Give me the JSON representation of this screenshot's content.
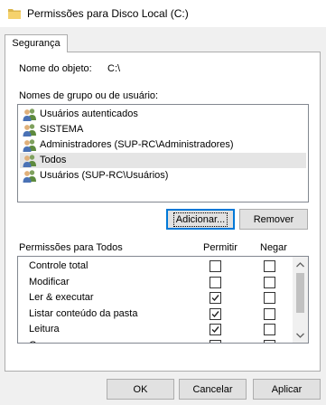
{
  "window": {
    "title": "Permissões para Disco Local (C:)",
    "icon": "folder-icon"
  },
  "tabs": [
    {
      "label": "Segurança",
      "active": true
    }
  ],
  "object": {
    "label": "Nome do objeto:",
    "value": "C:\\"
  },
  "groups": {
    "label": "Nomes de grupo ou de usuário:",
    "items": [
      {
        "label": "Usuários autenticados",
        "icon": "users-icon",
        "selected": false
      },
      {
        "label": "SISTEMA",
        "icon": "users-icon",
        "selected": false
      },
      {
        "label": "Administradores (SUP-RC\\Administradores)",
        "icon": "users-icon",
        "selected": false
      },
      {
        "label": "Todos",
        "icon": "users-icon",
        "selected": true
      },
      {
        "label": "Usuários (SUP-RC\\Usuários)",
        "icon": "users-icon",
        "selected": false
      }
    ],
    "add_label": "Adicionar...",
    "remove_label": "Remover"
  },
  "permissions": {
    "title": "Permissões para Todos",
    "allow_header": "Permitir",
    "deny_header": "Negar",
    "rows": [
      {
        "name": "Controle total",
        "allow": false,
        "deny": false
      },
      {
        "name": "Modificar",
        "allow": false,
        "deny": false
      },
      {
        "name": "Ler & executar",
        "allow": true,
        "deny": false
      },
      {
        "name": "Listar conteúdo da pasta",
        "allow": true,
        "deny": false
      },
      {
        "name": "Leitura",
        "allow": true,
        "deny": false
      },
      {
        "name": "Gravar",
        "allow": false,
        "deny": false
      }
    ]
  },
  "footer": {
    "ok_label": "OK",
    "cancel_label": "Cancelar",
    "apply_label": "Aplicar"
  },
  "colors": {
    "accent": "#0078d7",
    "selection": "#e5e5e5",
    "button": "#e1e1e1"
  }
}
